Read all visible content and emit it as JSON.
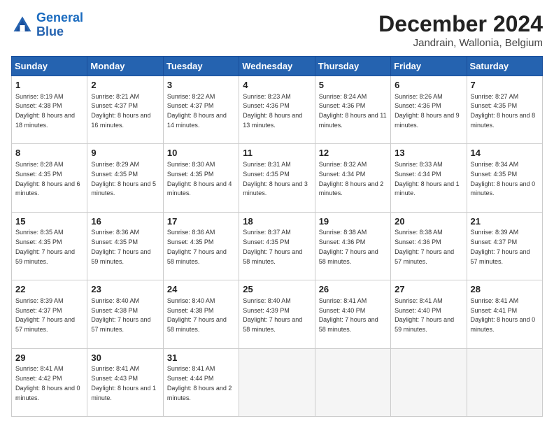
{
  "header": {
    "logo_line1": "General",
    "logo_line2": "Blue",
    "month_title": "December 2024",
    "location": "Jandrain, Wallonia, Belgium"
  },
  "days_of_week": [
    "Sunday",
    "Monday",
    "Tuesday",
    "Wednesday",
    "Thursday",
    "Friday",
    "Saturday"
  ],
  "weeks": [
    [
      {
        "day": "1",
        "sunrise": "8:19 AM",
        "sunset": "4:38 PM",
        "daylight": "8 hours and 18 minutes."
      },
      {
        "day": "2",
        "sunrise": "8:21 AM",
        "sunset": "4:37 PM",
        "daylight": "8 hours and 16 minutes."
      },
      {
        "day": "3",
        "sunrise": "8:22 AM",
        "sunset": "4:37 PM",
        "daylight": "8 hours and 14 minutes."
      },
      {
        "day": "4",
        "sunrise": "8:23 AM",
        "sunset": "4:36 PM",
        "daylight": "8 hours and 13 minutes."
      },
      {
        "day": "5",
        "sunrise": "8:24 AM",
        "sunset": "4:36 PM",
        "daylight": "8 hours and 11 minutes."
      },
      {
        "day": "6",
        "sunrise": "8:26 AM",
        "sunset": "4:36 PM",
        "daylight": "8 hours and 9 minutes."
      },
      {
        "day": "7",
        "sunrise": "8:27 AM",
        "sunset": "4:35 PM",
        "daylight": "8 hours and 8 minutes."
      }
    ],
    [
      {
        "day": "8",
        "sunrise": "8:28 AM",
        "sunset": "4:35 PM",
        "daylight": "8 hours and 6 minutes."
      },
      {
        "day": "9",
        "sunrise": "8:29 AM",
        "sunset": "4:35 PM",
        "daylight": "8 hours and 5 minutes."
      },
      {
        "day": "10",
        "sunrise": "8:30 AM",
        "sunset": "4:35 PM",
        "daylight": "8 hours and 4 minutes."
      },
      {
        "day": "11",
        "sunrise": "8:31 AM",
        "sunset": "4:35 PM",
        "daylight": "8 hours and 3 minutes."
      },
      {
        "day": "12",
        "sunrise": "8:32 AM",
        "sunset": "4:34 PM",
        "daylight": "8 hours and 2 minutes."
      },
      {
        "day": "13",
        "sunrise": "8:33 AM",
        "sunset": "4:34 PM",
        "daylight": "8 hours and 1 minute."
      },
      {
        "day": "14",
        "sunrise": "8:34 AM",
        "sunset": "4:35 PM",
        "daylight": "8 hours and 0 minutes."
      }
    ],
    [
      {
        "day": "15",
        "sunrise": "8:35 AM",
        "sunset": "4:35 PM",
        "daylight": "7 hours and 59 minutes."
      },
      {
        "day": "16",
        "sunrise": "8:36 AM",
        "sunset": "4:35 PM",
        "daylight": "7 hours and 59 minutes."
      },
      {
        "day": "17",
        "sunrise": "8:36 AM",
        "sunset": "4:35 PM",
        "daylight": "7 hours and 58 minutes."
      },
      {
        "day": "18",
        "sunrise": "8:37 AM",
        "sunset": "4:35 PM",
        "daylight": "7 hours and 58 minutes."
      },
      {
        "day": "19",
        "sunrise": "8:38 AM",
        "sunset": "4:36 PM",
        "daylight": "7 hours and 58 minutes."
      },
      {
        "day": "20",
        "sunrise": "8:38 AM",
        "sunset": "4:36 PM",
        "daylight": "7 hours and 57 minutes."
      },
      {
        "day": "21",
        "sunrise": "8:39 AM",
        "sunset": "4:37 PM",
        "daylight": "7 hours and 57 minutes."
      }
    ],
    [
      {
        "day": "22",
        "sunrise": "8:39 AM",
        "sunset": "4:37 PM",
        "daylight": "7 hours and 57 minutes."
      },
      {
        "day": "23",
        "sunrise": "8:40 AM",
        "sunset": "4:38 PM",
        "daylight": "7 hours and 57 minutes."
      },
      {
        "day": "24",
        "sunrise": "8:40 AM",
        "sunset": "4:38 PM",
        "daylight": "7 hours and 58 minutes."
      },
      {
        "day": "25",
        "sunrise": "8:40 AM",
        "sunset": "4:39 PM",
        "daylight": "7 hours and 58 minutes."
      },
      {
        "day": "26",
        "sunrise": "8:41 AM",
        "sunset": "4:40 PM",
        "daylight": "7 hours and 58 minutes."
      },
      {
        "day": "27",
        "sunrise": "8:41 AM",
        "sunset": "4:40 PM",
        "daylight": "7 hours and 59 minutes."
      },
      {
        "day": "28",
        "sunrise": "8:41 AM",
        "sunset": "4:41 PM",
        "daylight": "8 hours and 0 minutes."
      }
    ],
    [
      {
        "day": "29",
        "sunrise": "8:41 AM",
        "sunset": "4:42 PM",
        "daylight": "8 hours and 0 minutes."
      },
      {
        "day": "30",
        "sunrise": "8:41 AM",
        "sunset": "4:43 PM",
        "daylight": "8 hours and 1 minute."
      },
      {
        "day": "31",
        "sunrise": "8:41 AM",
        "sunset": "4:44 PM",
        "daylight": "8 hours and 2 minutes."
      },
      null,
      null,
      null,
      null
    ]
  ]
}
